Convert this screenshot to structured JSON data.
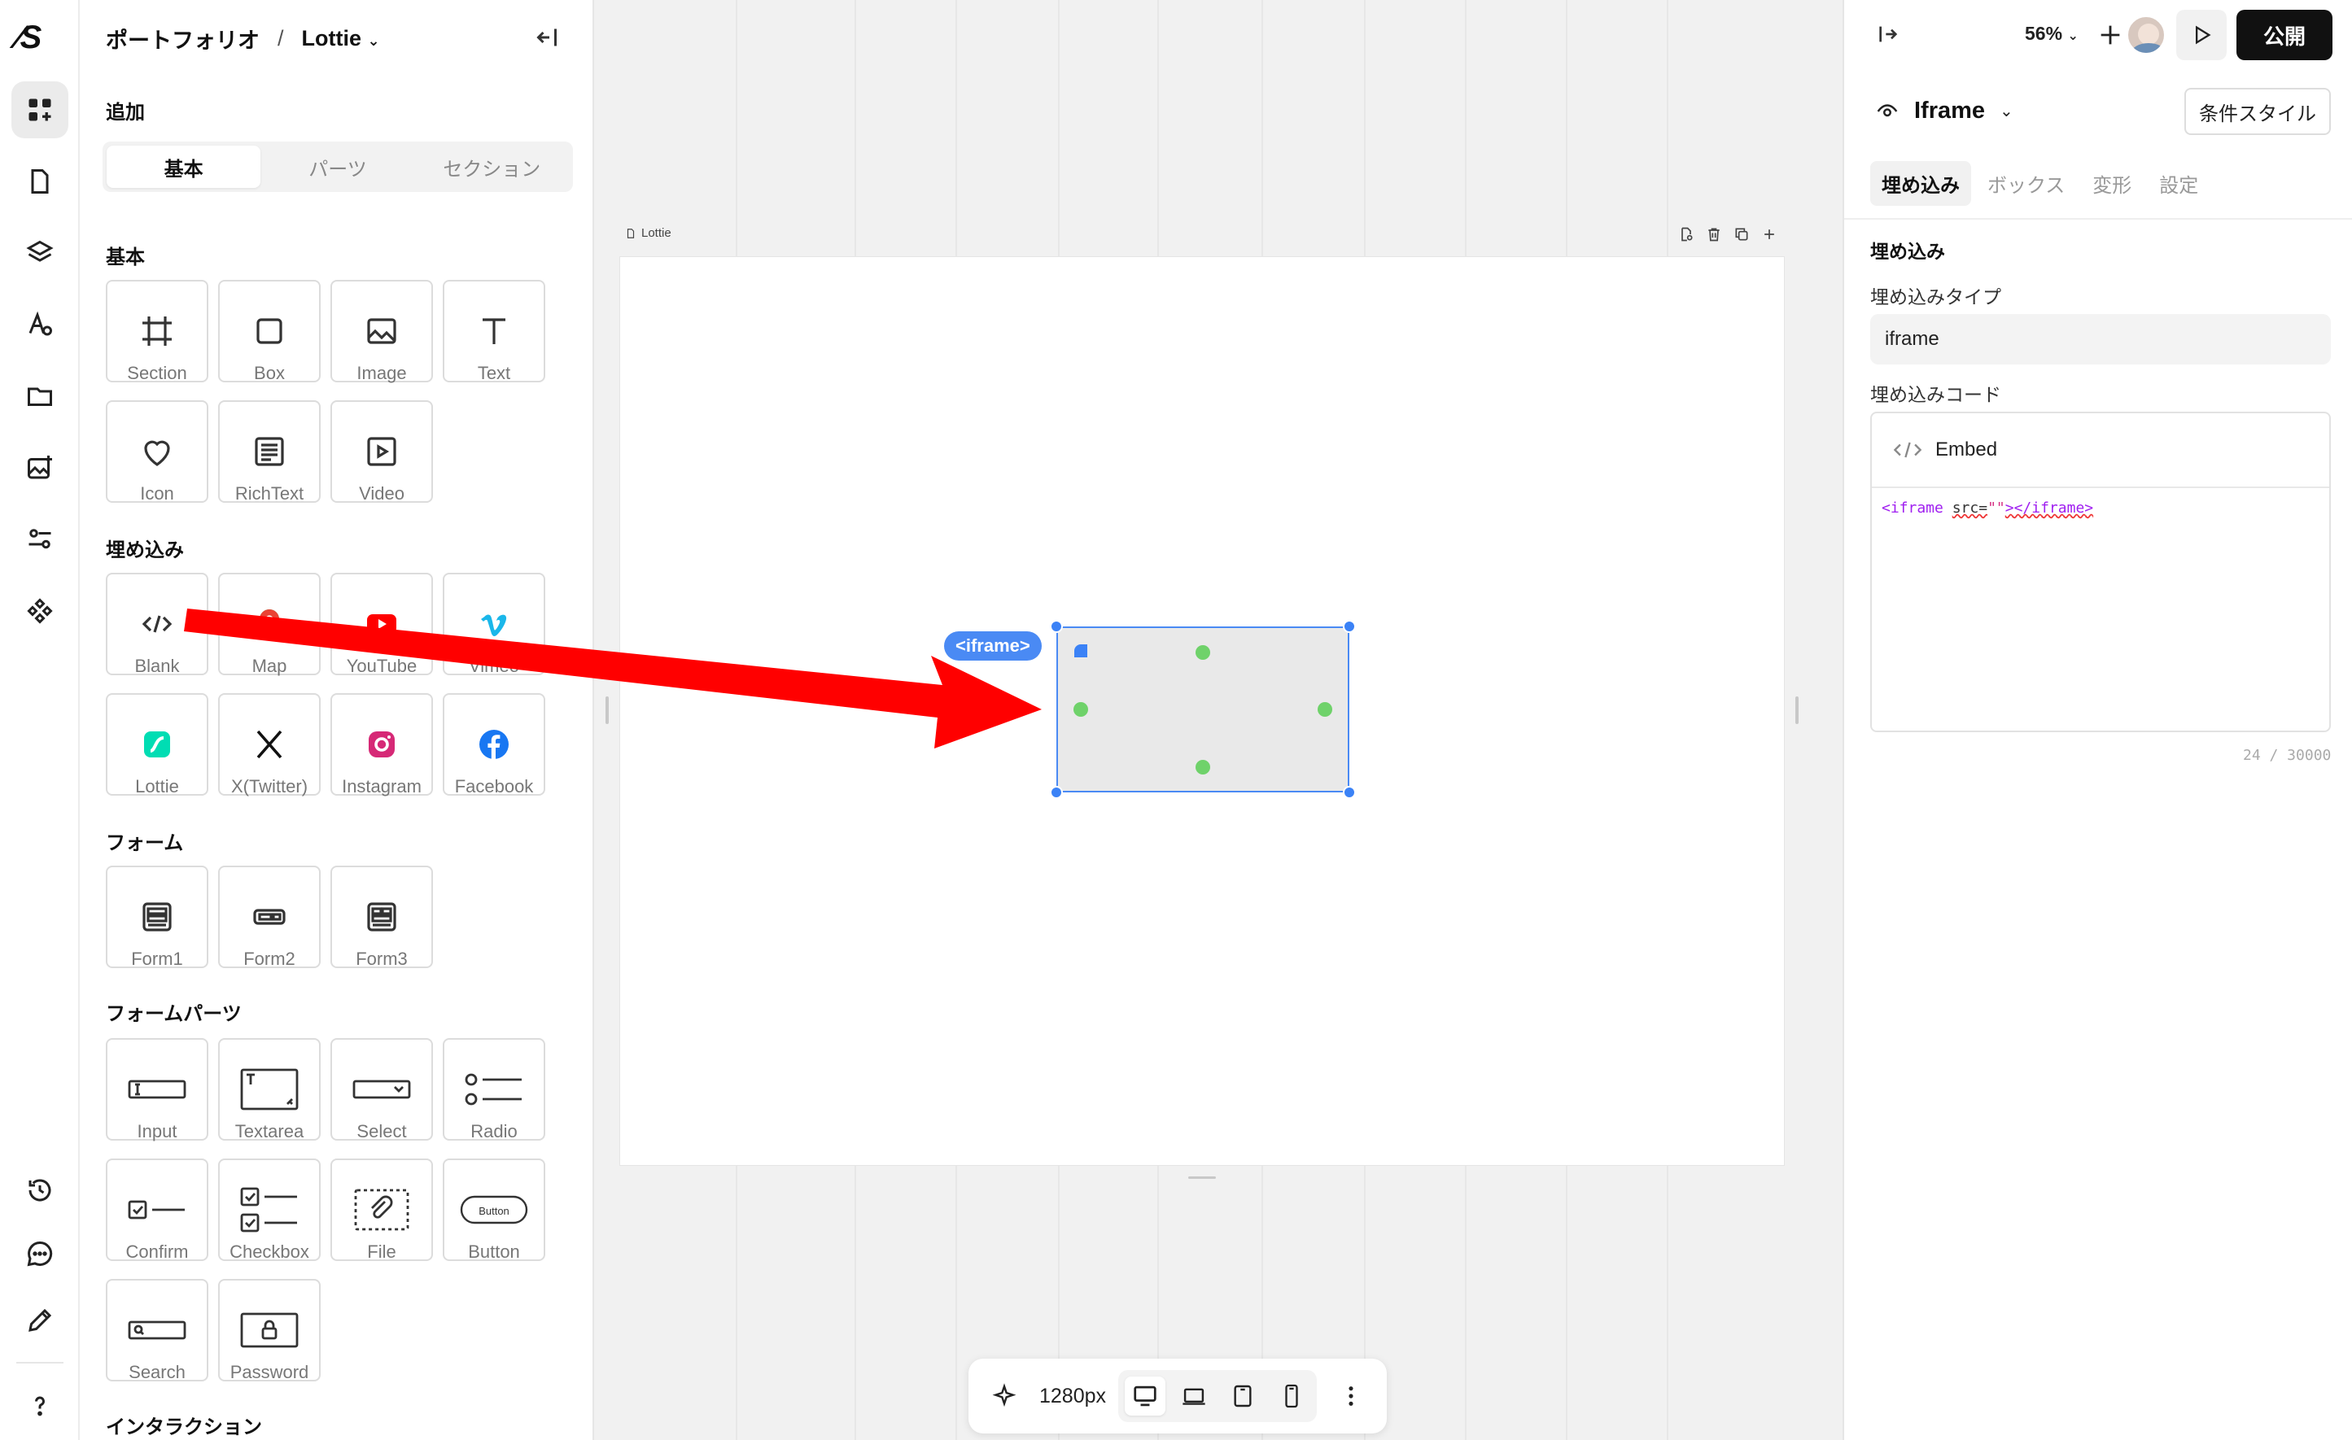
{
  "app": {
    "logo": "⁄S"
  },
  "left_panel": {
    "breadcrumb_parent": "ポートフォリオ",
    "breadcrumb_sep": "/",
    "page_name": "Lottie",
    "add_title": "追加",
    "tabs": [
      "基本",
      "パーツ",
      "セクション"
    ],
    "sections": {
      "basic": "基本",
      "embed": "埋め込み",
      "form": "フォーム",
      "form_parts": "フォームパーツ",
      "interaction": "インタラクション"
    },
    "basic_items": [
      "Section",
      "Box",
      "Image",
      "Text",
      "Icon",
      "RichText",
      "Video"
    ],
    "embed_items": [
      "Blank",
      "Map",
      "YouTube",
      "Vimeo",
      "Lottie",
      "X(Twitter)",
      "Instagram",
      "Facebook"
    ],
    "form_items": [
      "Form1",
      "Form2",
      "Form3"
    ],
    "form_part_items": [
      "Input",
      "Textarea",
      "Select",
      "Radio",
      "Confirm",
      "Checkbox",
      "File",
      "Button",
      "Search",
      "Password"
    ]
  },
  "canvas": {
    "frame_label": "Lottie",
    "selected_tag": "<iframe>",
    "width_label": "1280px"
  },
  "right_panel": {
    "zoom": "56%",
    "publish": "公開",
    "element_name": "Iframe",
    "conditional_style": "条件スタイル",
    "tabs": [
      "埋め込み",
      "ボックス",
      "変形",
      "設定"
    ],
    "section_title": "埋め込み",
    "embed_type_label": "埋め込みタイプ",
    "embed_type_value": "iframe",
    "embed_code_label": "埋め込みコード",
    "code_header": "Embed",
    "code_tag_open": "<iframe",
    "code_attr": "src=",
    "code_val": "\"\"",
    "code_tag_close": "></iframe>",
    "counter": "24 / 30000"
  },
  "colors": {
    "accent": "#3b82f6",
    "arrow": "#ff0000",
    "dot": "#6fd26a"
  }
}
